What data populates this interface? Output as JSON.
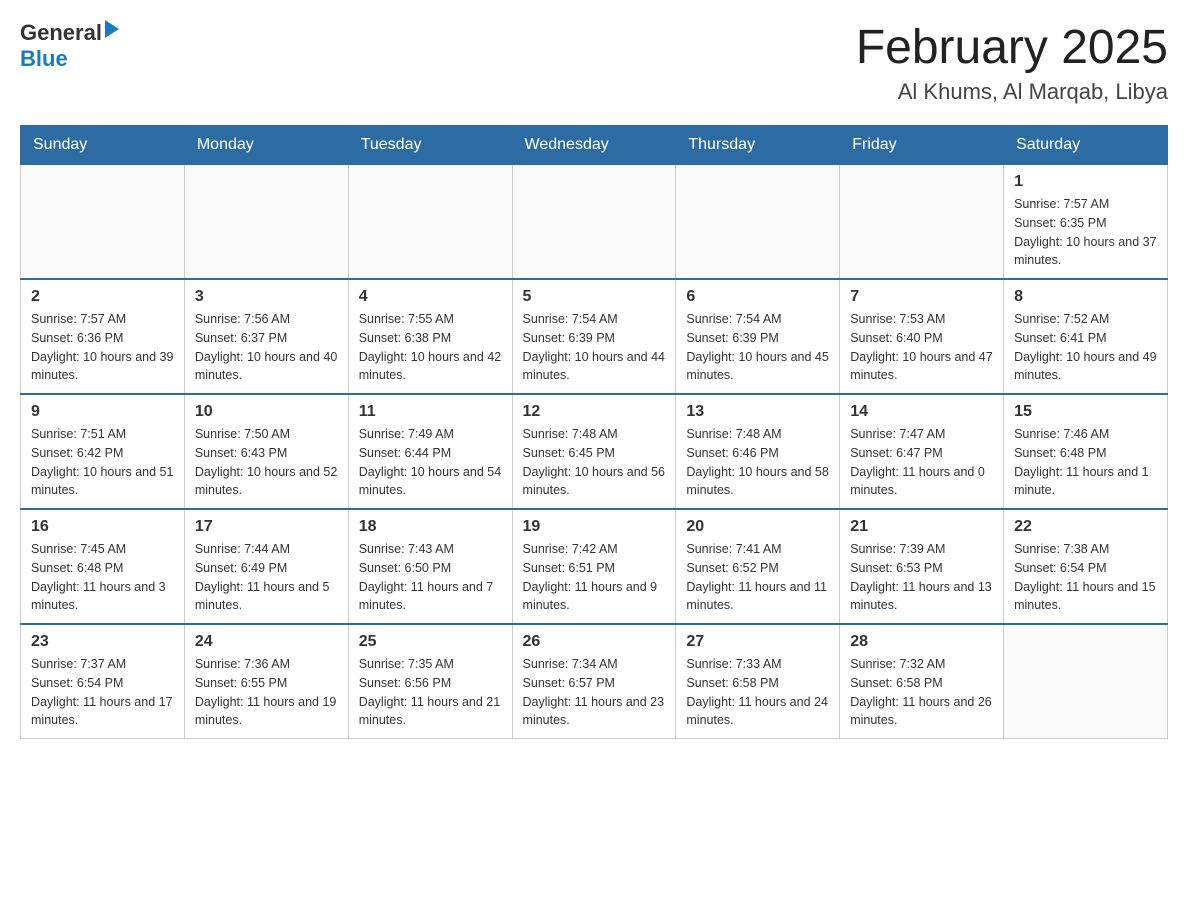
{
  "header": {
    "logo": {
      "general": "General",
      "blue": "Blue"
    },
    "title": "February 2025",
    "location": "Al Khums, Al Marqab, Libya"
  },
  "days_of_week": [
    "Sunday",
    "Monday",
    "Tuesday",
    "Wednesday",
    "Thursday",
    "Friday",
    "Saturday"
  ],
  "weeks": [
    [
      {
        "day": "",
        "sunrise": "",
        "sunset": "",
        "daylight": ""
      },
      {
        "day": "",
        "sunrise": "",
        "sunset": "",
        "daylight": ""
      },
      {
        "day": "",
        "sunrise": "",
        "sunset": "",
        "daylight": ""
      },
      {
        "day": "",
        "sunrise": "",
        "sunset": "",
        "daylight": ""
      },
      {
        "day": "",
        "sunrise": "",
        "sunset": "",
        "daylight": ""
      },
      {
        "day": "",
        "sunrise": "",
        "sunset": "",
        "daylight": ""
      },
      {
        "day": "1",
        "sunrise": "Sunrise: 7:57 AM",
        "sunset": "Sunset: 6:35 PM",
        "daylight": "Daylight: 10 hours and 37 minutes."
      }
    ],
    [
      {
        "day": "2",
        "sunrise": "Sunrise: 7:57 AM",
        "sunset": "Sunset: 6:36 PM",
        "daylight": "Daylight: 10 hours and 39 minutes."
      },
      {
        "day": "3",
        "sunrise": "Sunrise: 7:56 AM",
        "sunset": "Sunset: 6:37 PM",
        "daylight": "Daylight: 10 hours and 40 minutes."
      },
      {
        "day": "4",
        "sunrise": "Sunrise: 7:55 AM",
        "sunset": "Sunset: 6:38 PM",
        "daylight": "Daylight: 10 hours and 42 minutes."
      },
      {
        "day": "5",
        "sunrise": "Sunrise: 7:54 AM",
        "sunset": "Sunset: 6:39 PM",
        "daylight": "Daylight: 10 hours and 44 minutes."
      },
      {
        "day": "6",
        "sunrise": "Sunrise: 7:54 AM",
        "sunset": "Sunset: 6:39 PM",
        "daylight": "Daylight: 10 hours and 45 minutes."
      },
      {
        "day": "7",
        "sunrise": "Sunrise: 7:53 AM",
        "sunset": "Sunset: 6:40 PM",
        "daylight": "Daylight: 10 hours and 47 minutes."
      },
      {
        "day": "8",
        "sunrise": "Sunrise: 7:52 AM",
        "sunset": "Sunset: 6:41 PM",
        "daylight": "Daylight: 10 hours and 49 minutes."
      }
    ],
    [
      {
        "day": "9",
        "sunrise": "Sunrise: 7:51 AM",
        "sunset": "Sunset: 6:42 PM",
        "daylight": "Daylight: 10 hours and 51 minutes."
      },
      {
        "day": "10",
        "sunrise": "Sunrise: 7:50 AM",
        "sunset": "Sunset: 6:43 PM",
        "daylight": "Daylight: 10 hours and 52 minutes."
      },
      {
        "day": "11",
        "sunrise": "Sunrise: 7:49 AM",
        "sunset": "Sunset: 6:44 PM",
        "daylight": "Daylight: 10 hours and 54 minutes."
      },
      {
        "day": "12",
        "sunrise": "Sunrise: 7:48 AM",
        "sunset": "Sunset: 6:45 PM",
        "daylight": "Daylight: 10 hours and 56 minutes."
      },
      {
        "day": "13",
        "sunrise": "Sunrise: 7:48 AM",
        "sunset": "Sunset: 6:46 PM",
        "daylight": "Daylight: 10 hours and 58 minutes."
      },
      {
        "day": "14",
        "sunrise": "Sunrise: 7:47 AM",
        "sunset": "Sunset: 6:47 PM",
        "daylight": "Daylight: 11 hours and 0 minutes."
      },
      {
        "day": "15",
        "sunrise": "Sunrise: 7:46 AM",
        "sunset": "Sunset: 6:48 PM",
        "daylight": "Daylight: 11 hours and 1 minute."
      }
    ],
    [
      {
        "day": "16",
        "sunrise": "Sunrise: 7:45 AM",
        "sunset": "Sunset: 6:48 PM",
        "daylight": "Daylight: 11 hours and 3 minutes."
      },
      {
        "day": "17",
        "sunrise": "Sunrise: 7:44 AM",
        "sunset": "Sunset: 6:49 PM",
        "daylight": "Daylight: 11 hours and 5 minutes."
      },
      {
        "day": "18",
        "sunrise": "Sunrise: 7:43 AM",
        "sunset": "Sunset: 6:50 PM",
        "daylight": "Daylight: 11 hours and 7 minutes."
      },
      {
        "day": "19",
        "sunrise": "Sunrise: 7:42 AM",
        "sunset": "Sunset: 6:51 PM",
        "daylight": "Daylight: 11 hours and 9 minutes."
      },
      {
        "day": "20",
        "sunrise": "Sunrise: 7:41 AM",
        "sunset": "Sunset: 6:52 PM",
        "daylight": "Daylight: 11 hours and 11 minutes."
      },
      {
        "day": "21",
        "sunrise": "Sunrise: 7:39 AM",
        "sunset": "Sunset: 6:53 PM",
        "daylight": "Daylight: 11 hours and 13 minutes."
      },
      {
        "day": "22",
        "sunrise": "Sunrise: 7:38 AM",
        "sunset": "Sunset: 6:54 PM",
        "daylight": "Daylight: 11 hours and 15 minutes."
      }
    ],
    [
      {
        "day": "23",
        "sunrise": "Sunrise: 7:37 AM",
        "sunset": "Sunset: 6:54 PM",
        "daylight": "Daylight: 11 hours and 17 minutes."
      },
      {
        "day": "24",
        "sunrise": "Sunrise: 7:36 AM",
        "sunset": "Sunset: 6:55 PM",
        "daylight": "Daylight: 11 hours and 19 minutes."
      },
      {
        "day": "25",
        "sunrise": "Sunrise: 7:35 AM",
        "sunset": "Sunset: 6:56 PM",
        "daylight": "Daylight: 11 hours and 21 minutes."
      },
      {
        "day": "26",
        "sunrise": "Sunrise: 7:34 AM",
        "sunset": "Sunset: 6:57 PM",
        "daylight": "Daylight: 11 hours and 23 minutes."
      },
      {
        "day": "27",
        "sunrise": "Sunrise: 7:33 AM",
        "sunset": "Sunset: 6:58 PM",
        "daylight": "Daylight: 11 hours and 24 minutes."
      },
      {
        "day": "28",
        "sunrise": "Sunrise: 7:32 AM",
        "sunset": "Sunset: 6:58 PM",
        "daylight": "Daylight: 11 hours and 26 minutes."
      },
      {
        "day": "",
        "sunrise": "",
        "sunset": "",
        "daylight": ""
      }
    ]
  ]
}
